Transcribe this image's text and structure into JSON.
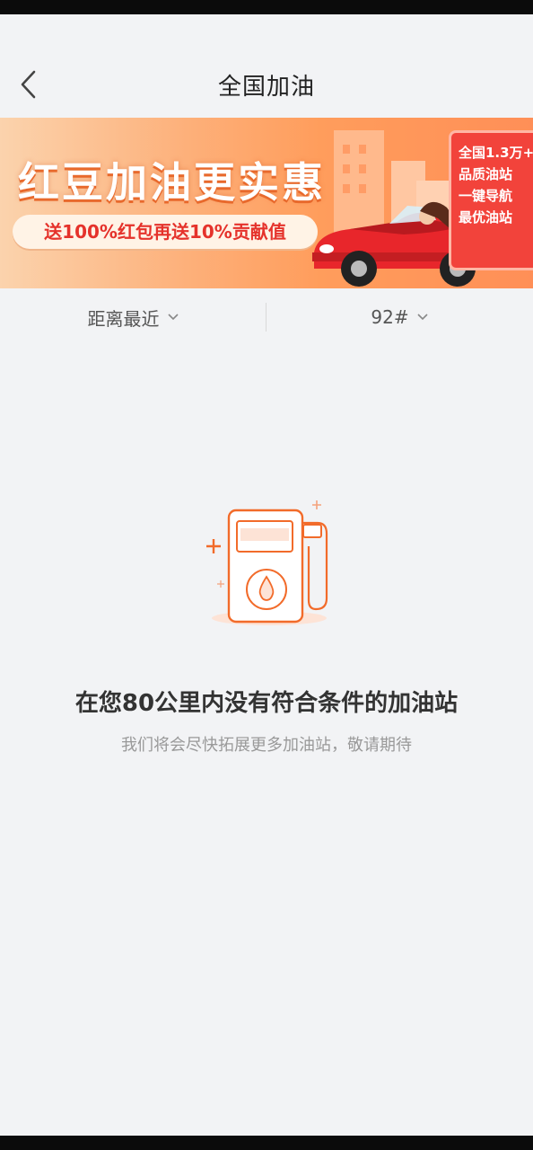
{
  "header": {
    "title": "全国加油"
  },
  "banner": {
    "headline": "红豆加油更实惠",
    "subline": "送100%红包再送10%贡献值",
    "card_lines": [
      "全国1.3万+",
      "品质油站",
      "一键导航",
      "最优油站"
    ],
    "colors": {
      "accent": "#ff8f57",
      "card": "#f2433b",
      "headline_shadow": "#e8692c"
    }
  },
  "filters": {
    "sort_label": "距离最近",
    "fuel_label": "92#"
  },
  "empty": {
    "title": "在您80公里内没有符合条件的加油站",
    "subtitle": "我们将会尽快拓展更多加油站，敬请期待",
    "icon": "fuel-pump-icon",
    "accent": "#f26b2a"
  }
}
